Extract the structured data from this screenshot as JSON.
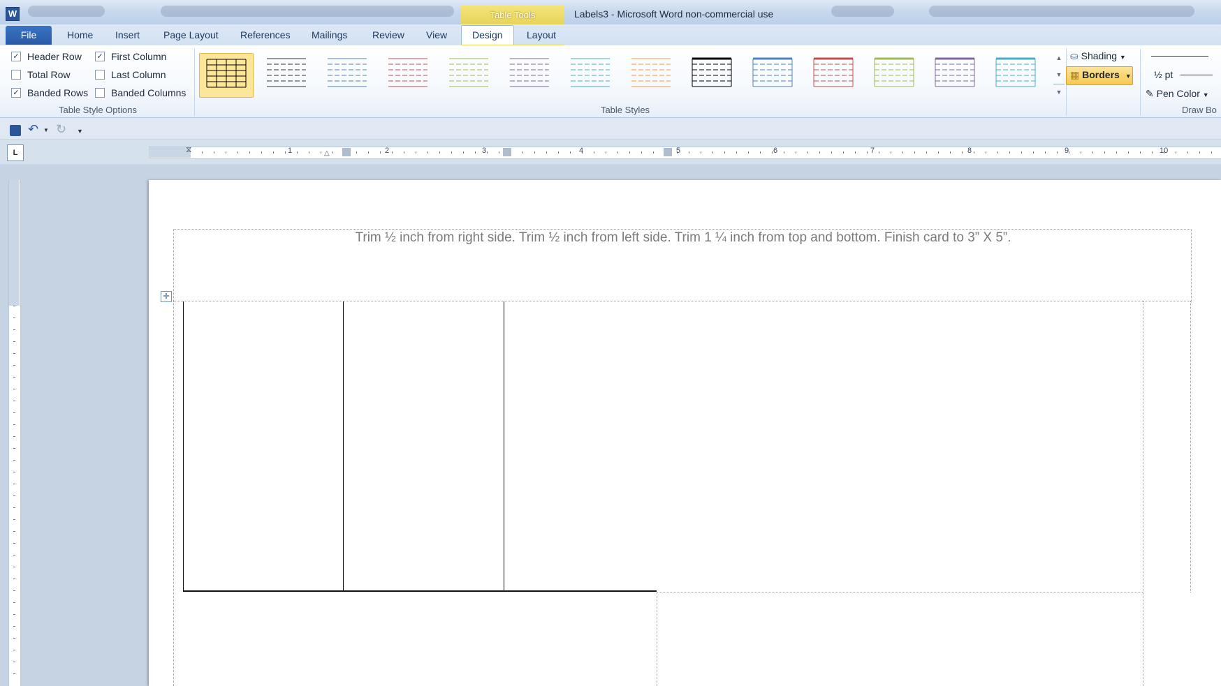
{
  "titlebar": {
    "app_icon": "W",
    "context_tab_group": "Table Tools",
    "window_title": "Labels3  -  Microsoft Word non-commercial use"
  },
  "ribbon_tabs": {
    "file": "File",
    "home": "Home",
    "insert": "Insert",
    "page_layout": "Page Layout",
    "references": "References",
    "mailings": "Mailings",
    "review": "Review",
    "view": "View",
    "design": "Design",
    "layout": "Layout"
  },
  "table_style_options": {
    "label": "Table Style Options",
    "header_row": {
      "label": "Header Row",
      "checked": true
    },
    "first_column": {
      "label": "First Column",
      "checked": true
    },
    "total_row": {
      "label": "Total Row",
      "checked": false
    },
    "last_column": {
      "label": "Last Column",
      "checked": false
    },
    "banded_rows": {
      "label": "Banded Rows",
      "checked": true
    },
    "banded_columns": {
      "label": "Banded Columns",
      "checked": false
    }
  },
  "table_styles": {
    "label": "Table Styles",
    "colors": [
      "#000000",
      "#333333",
      "#4f81bd",
      "#c0504d",
      "#9bbb59",
      "#8064a2",
      "#4bacc6",
      "#f79646",
      "#000000",
      "#4f81bd",
      "#c0504d",
      "#9bbb59",
      "#8064a2",
      "#4bacc6"
    ]
  },
  "shading": {
    "label": "Shading"
  },
  "borders": {
    "label": "Borders"
  },
  "draw_borders": {
    "pen_weight": "½ pt",
    "pen_color": "Pen Color",
    "label": "Draw Bo"
  },
  "ruler": {
    "numbers": [
      "1",
      "2",
      "3",
      "4",
      "5",
      "6",
      "7",
      "8",
      "9",
      "10"
    ]
  },
  "document": {
    "trim_text": "Trim ½ inch from right side.  Trim ½ inch from left side.  Trim 1 ¼ inch from top and bottom.  Finish card to 3” X 5”."
  },
  "tab_selector": "L"
}
